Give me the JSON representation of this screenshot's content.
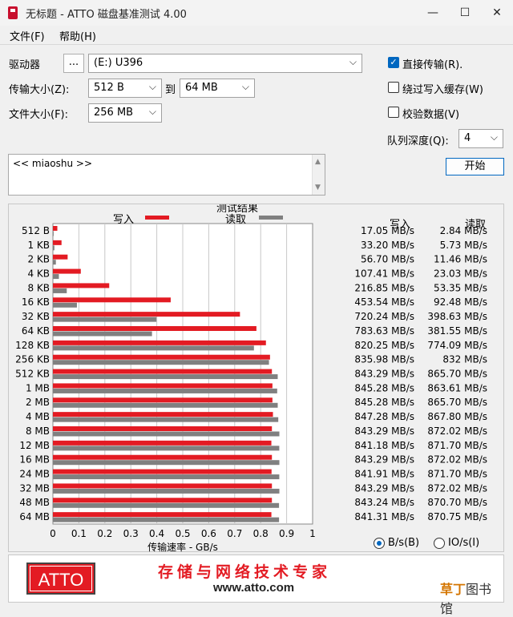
{
  "window": {
    "title": "无标题 - ATTO 磁盘基准测试 4.00",
    "minimize": "—",
    "maximize": "☐",
    "close": "✕"
  },
  "menu": [
    {
      "label": "文件(F)"
    },
    {
      "label": "帮助(H)"
    }
  ],
  "drive": {
    "label": "驱动器",
    "browse": "...",
    "value": "(E:) U396"
  },
  "transfer_size": {
    "label": "传输大小(Z):",
    "from": "512 B",
    "to_label": "到",
    "to": "64 MB"
  },
  "file_size": {
    "label": "文件大小(F):",
    "value": "256 MB"
  },
  "options": {
    "direct_io": {
      "label": "直接传输(R).",
      "checked": true
    },
    "bypass_cache": {
      "label": "绕过写入缓存(W)",
      "checked": false
    },
    "verify": {
      "label": "校验数据(V)",
      "checked": false
    },
    "queue_label": "队列深度(Q):",
    "queue_value": "4",
    "start_button": "开始"
  },
  "description": "<< miaoshu >>",
  "results": {
    "title": "测试结果",
    "legend_write": "写入",
    "legend_read": "读取",
    "col_write": "写入",
    "col_read": "读取",
    "write_text": [
      "17.05 MB/s",
      "33.20 MB/s",
      "56.70 MB/s",
      "107.41 MB/s",
      "216.85 MB/s",
      "453.54 MB/s",
      "720.24 MB/s",
      "783.63 MB/s",
      "820.25 MB/s",
      "835.98 MB/s",
      "843.29 MB/s",
      "845.28 MB/s",
      "845.28 MB/s",
      "847.28 MB/s",
      "843.29 MB/s",
      "841.18 MB/s",
      "843.29 MB/s",
      "841.91 MB/s",
      "843.29 MB/s",
      "843.24 MB/s",
      "841.31 MB/s"
    ],
    "read_text": [
      "2.84 MB/s",
      "5.73 MB/s",
      "11.46 MB/s",
      "23.03 MB/s",
      "53.35 MB/s",
      "92.48 MB/s",
      "398.63 MB/s",
      "381.55 MB/s",
      "774.09 MB/s",
      "832 MB/s",
      "865.70 MB/s",
      "863.61 MB/s",
      "865.70 MB/s",
      "867.80 MB/s",
      "872.02 MB/s",
      "871.70 MB/s",
      "872.02 MB/s",
      "871.70 MB/s",
      "872.02 MB/s",
      "870.70 MB/s",
      "870.75 MB/s"
    ]
  },
  "chart_data": {
    "type": "bar",
    "orientation": "horizontal",
    "categories": [
      "512 B",
      "1 KB",
      "2 KB",
      "4 KB",
      "8 KB",
      "16 KB",
      "32 KB",
      "64 KB",
      "128 KB",
      "256 KB",
      "512 KB",
      "1 MB",
      "2 MB",
      "4 MB",
      "8 MB",
      "12 MB",
      "16 MB",
      "24 MB",
      "32 MB",
      "48 MB",
      "64 MB"
    ],
    "series": [
      {
        "name": "写入",
        "color": "#e31b23",
        "values": [
          0.01705,
          0.0332,
          0.0567,
          0.10741,
          0.21685,
          0.45354,
          0.72024,
          0.78363,
          0.82025,
          0.83598,
          0.84329,
          0.84528,
          0.84528,
          0.84728,
          0.84329,
          0.84118,
          0.84329,
          0.84191,
          0.84329,
          0.84324,
          0.84131
        ]
      },
      {
        "name": "读取",
        "color": "#808080",
        "values": [
          0.00284,
          0.00573,
          0.01146,
          0.02303,
          0.05335,
          0.09248,
          0.39863,
          0.38155,
          0.77409,
          0.832,
          0.8657,
          0.86361,
          0.8657,
          0.8678,
          0.87202,
          0.8717,
          0.87202,
          0.8717,
          0.87202,
          0.8707,
          0.87075
        ]
      }
    ],
    "xlabel": "传输速率 - GB/s",
    "xlim": [
      0,
      1
    ],
    "xticks": [
      "0",
      "0.1",
      "0.2",
      "0.3",
      "0.4",
      "0.5",
      "0.6",
      "0.7",
      "0.8",
      "0.9",
      "1"
    ],
    "grid": true
  },
  "units": {
    "bytes": "B/s(B)",
    "io": "IO/s(I)",
    "selected": "bytes"
  },
  "banner": {
    "logo": "ATTO",
    "slogan": "存储与网络技术专家",
    "url": "www.atto.com"
  },
  "watermark": {
    "lead": "草丁",
    "rest": "图书馆"
  }
}
